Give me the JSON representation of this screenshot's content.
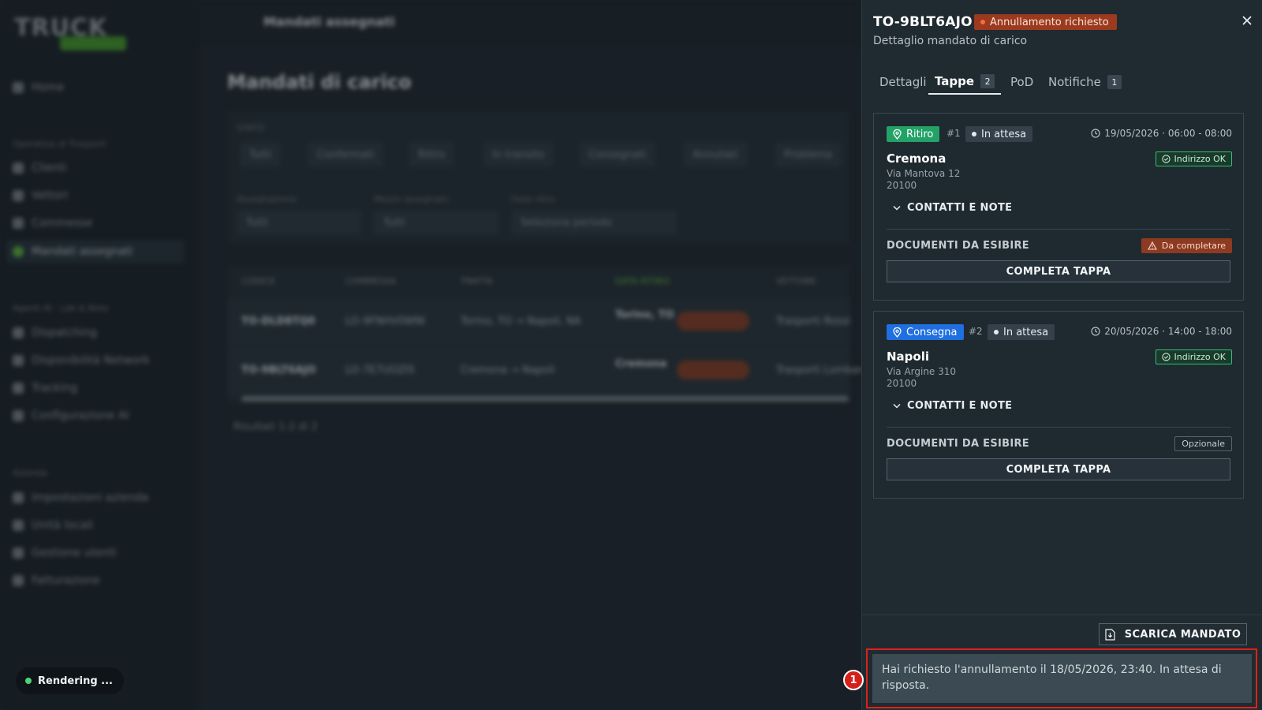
{
  "background": {
    "logo": {
      "word": "TRUCK"
    },
    "topbar_title": "Mandati assegnati",
    "page_title": "Mandati di carico",
    "sidebar": {
      "section1": "Operativa di Trasporti",
      "section2": "Agenti AI · Lab & Beta",
      "section3": "Azienda",
      "items": [
        {
          "label": "Home"
        },
        {
          "label": "Clienti"
        },
        {
          "label": "Vettori"
        },
        {
          "label": "Commesse"
        },
        {
          "label": "Mandati assegnati"
        },
        {
          "label": "Dispatching"
        },
        {
          "label": "Disponibilità Network"
        },
        {
          "label": "Tracking"
        },
        {
          "label": "Configurazione AI"
        },
        {
          "label": "Impostazioni azienda"
        },
        {
          "label": "Unità locali"
        },
        {
          "label": "Gestione utenti"
        },
        {
          "label": "Fatturazione"
        }
      ]
    },
    "filters": {
      "section_label": "STATO",
      "chips": [
        "Tutti",
        "Confermati",
        "Ritiro",
        "In transito",
        "Consegnati",
        "Annullati",
        "Problema"
      ],
      "labels": [
        "Assegnazione",
        "Mezzo assegnato",
        "Data ritiro"
      ],
      "selects": [
        "Tutti",
        "Tutti",
        "Seleziona periodo"
      ]
    },
    "table": {
      "headers": [
        "CODICE",
        "COMMESSA",
        "TRATTA",
        "DATA RITIRO",
        "VETTORE"
      ],
      "rows": [
        [
          "TO-DLD8TQ0",
          "LO-9FNHV0WNI",
          "Torino, TO → Napoli, NA",
          "Torino, TO",
          "Trasporti Rossi"
        ],
        [
          "TO-9BLT6AJO",
          "LO-7E7UOZIS",
          "Cremona → Napoli",
          "Cremona",
          "Trasporti Lombardi"
        ]
      ]
    },
    "results": "Risultati 1-2 di 2"
  },
  "rendering_pill": {
    "label": "Rendering ..."
  },
  "drawer": {
    "title": "TO-9BLT6AJO",
    "status_badge": "Annullamento richiesto",
    "subtitle": "Dettaglio mandato di carico",
    "tabs": [
      {
        "label": "Dettagli"
      },
      {
        "label": "Tappe",
        "count": "2"
      },
      {
        "label": "PoD"
      },
      {
        "label": "Notifiche",
        "count": "1"
      }
    ],
    "stops": [
      {
        "type": "Ritiro",
        "number": "#1",
        "state": "In attesa",
        "time": "19/05/2026 · 06:00 - 08:00",
        "city": "Cremona",
        "address": "Via Mantova 12",
        "zip": "20100",
        "address_status": "Indirizzo OK",
        "contacts_label": "CONTATTI E NOTE",
        "docs_label": "DOCUMENTI DA ESIBIRE",
        "docs_status": "Da completare",
        "action_label": "COMPLETA TAPPA"
      },
      {
        "type": "Consegna",
        "number": "#2",
        "state": "In attesa",
        "time": "20/05/2026 · 14:00 - 18:00",
        "city": "Napoli",
        "address": "Via Argine 310",
        "zip": "20100",
        "address_status": "Indirizzo OK",
        "contacts_label": "CONTATTI E NOTE",
        "docs_label": "DOCUMENTI DA ESIBIRE",
        "docs_status": "Opzionale",
        "action_label": "COMPLETA TAPPA"
      }
    ],
    "download_label": "SCARICA MANDATO",
    "notice": "Hai richiesto l'annullamento il 18/05/2026, 23:40. In attesa di risposta."
  },
  "annotation": {
    "marker": "1"
  },
  "colors": {
    "accent_green": "#23a267",
    "accent_blue": "#1f6fe0",
    "danger": "#9b3a1e",
    "highlight_red": "#e0211a"
  }
}
